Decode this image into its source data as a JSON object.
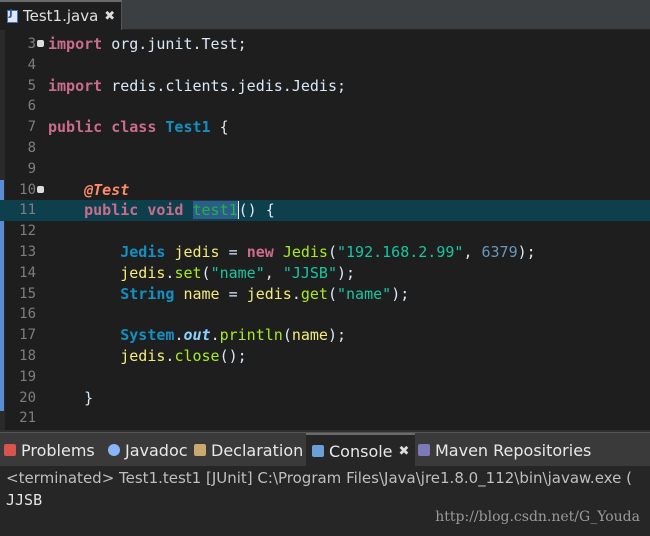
{
  "editor": {
    "tab_label": "Test1.java",
    "tab_close": "✖",
    "lines": [
      {
        "num": "3",
        "fold": true,
        "segs": [
          {
            "t": "import",
            "c": "kw"
          },
          {
            "t": " org.junit.Test;",
            "c": "plain"
          }
        ]
      },
      {
        "num": "4",
        "segs": []
      },
      {
        "num": "5",
        "segs": [
          {
            "t": "import",
            "c": "kw"
          },
          {
            "t": " redis.clients.jedis.Jedis;",
            "c": "plain"
          }
        ]
      },
      {
        "num": "6",
        "segs": []
      },
      {
        "num": "7",
        "segs": [
          {
            "t": "public",
            "c": "kw"
          },
          {
            "t": " ",
            "c": "plain"
          },
          {
            "t": "class",
            "c": "kw"
          },
          {
            "t": " ",
            "c": "plain"
          },
          {
            "t": "Test1",
            "c": "cls"
          },
          {
            "t": " {",
            "c": "plain"
          }
        ]
      },
      {
        "num": "8",
        "segs": []
      },
      {
        "num": "9",
        "segs": []
      },
      {
        "num": "10",
        "fold": true,
        "changed": true,
        "segs": [
          {
            "t": "    ",
            "c": "plain"
          },
          {
            "t": "@Test",
            "c": "ann"
          }
        ]
      },
      {
        "num": "11",
        "current": true,
        "changed": true,
        "segs": [
          {
            "t": "    ",
            "c": "plain"
          },
          {
            "t": "public",
            "c": "kw"
          },
          {
            "t": " ",
            "c": "plain"
          },
          {
            "t": "void",
            "c": "kw"
          },
          {
            "t": " ",
            "c": "plain"
          },
          {
            "t": "test1",
            "c": "def sel caret-after"
          },
          {
            "t": "() {",
            "c": "plain"
          }
        ]
      },
      {
        "num": "12",
        "changed": true,
        "segs": []
      },
      {
        "num": "13",
        "changed": true,
        "segs": [
          {
            "t": "        ",
            "c": "plain"
          },
          {
            "t": "Jedis",
            "c": "cls"
          },
          {
            "t": " ",
            "c": "plain"
          },
          {
            "t": "jedis",
            "c": "var"
          },
          {
            "t": " = ",
            "c": "plain"
          },
          {
            "t": "new",
            "c": "kw"
          },
          {
            "t": " ",
            "c": "plain"
          },
          {
            "t": "Jedis",
            "c": "meth"
          },
          {
            "t": "(",
            "c": "plain"
          },
          {
            "t": "\"192.168.2.99\"",
            "c": "str"
          },
          {
            "t": ", ",
            "c": "plain"
          },
          {
            "t": "6379",
            "c": "num"
          },
          {
            "t": ");",
            "c": "plain"
          }
        ]
      },
      {
        "num": "14",
        "changed": true,
        "segs": [
          {
            "t": "        ",
            "c": "plain"
          },
          {
            "t": "jedis",
            "c": "var"
          },
          {
            "t": ".",
            "c": "plain"
          },
          {
            "t": "set",
            "c": "meth"
          },
          {
            "t": "(",
            "c": "plain"
          },
          {
            "t": "\"name\"",
            "c": "str"
          },
          {
            "t": ", ",
            "c": "plain"
          },
          {
            "t": "\"JJSB\"",
            "c": "str"
          },
          {
            "t": ");",
            "c": "plain"
          }
        ]
      },
      {
        "num": "15",
        "changed": true,
        "segs": [
          {
            "t": "        ",
            "c": "plain"
          },
          {
            "t": "String",
            "c": "cls"
          },
          {
            "t": " ",
            "c": "plain"
          },
          {
            "t": "name",
            "c": "var"
          },
          {
            "t": " = ",
            "c": "plain"
          },
          {
            "t": "jedis",
            "c": "var"
          },
          {
            "t": ".",
            "c": "plain"
          },
          {
            "t": "get",
            "c": "meth"
          },
          {
            "t": "(",
            "c": "plain"
          },
          {
            "t": "\"name\"",
            "c": "str"
          },
          {
            "t": ");",
            "c": "plain"
          }
        ]
      },
      {
        "num": "16",
        "changed": true,
        "segs": []
      },
      {
        "num": "17",
        "changed": true,
        "segs": [
          {
            "t": "        ",
            "c": "plain"
          },
          {
            "t": "System",
            "c": "cls"
          },
          {
            "t": ".",
            "c": "plain"
          },
          {
            "t": "out",
            "c": "fld"
          },
          {
            "t": ".",
            "c": "plain"
          },
          {
            "t": "println",
            "c": "meth"
          },
          {
            "t": "(",
            "c": "plain"
          },
          {
            "t": "name",
            "c": "var"
          },
          {
            "t": ");",
            "c": "plain"
          }
        ]
      },
      {
        "num": "18",
        "changed": true,
        "segs": [
          {
            "t": "        ",
            "c": "plain"
          },
          {
            "t": "jedis",
            "c": "var"
          },
          {
            "t": ".",
            "c": "plain"
          },
          {
            "t": "close",
            "c": "meth"
          },
          {
            "t": "();",
            "c": "plain"
          }
        ]
      },
      {
        "num": "19",
        "changed": true,
        "segs": []
      },
      {
        "num": "20",
        "changed": true,
        "segs": [
          {
            "t": "    }",
            "c": "plain"
          }
        ]
      },
      {
        "num": "21",
        "segs": []
      }
    ]
  },
  "views": {
    "tabs": [
      {
        "label": "Problems",
        "icon": "problems-icon",
        "color": "#d9534f"
      },
      {
        "label": "Javadoc",
        "icon": "javadoc-icon",
        "color": "#8ab4f8"
      },
      {
        "label": "Declaration",
        "icon": "declaration-icon",
        "color": "#c9a96e"
      },
      {
        "label": "Console",
        "icon": "console-icon",
        "color": "#6aa0d8",
        "active": true,
        "close": "✖"
      },
      {
        "label": "Maven Repositories",
        "icon": "maven-icon",
        "color": "#7a7ab8"
      }
    ]
  },
  "console": {
    "header": "<terminated> Test1.test1 [JUnit] C:\\Program Files\\Java\\jre1.8.0_112\\bin\\javaw.exe (",
    "output": "JJSB",
    "watermark": "http://blog.csdn.net/G_Youda"
  }
}
